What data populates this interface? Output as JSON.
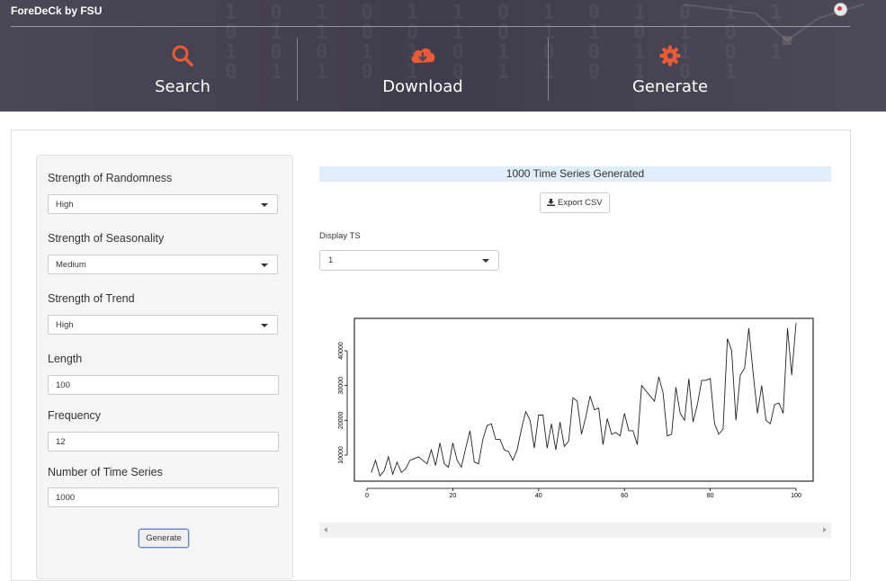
{
  "header": {
    "brand": "ForeDeCk by FSU",
    "nav": [
      {
        "label": "Search",
        "icon": "search-icon"
      },
      {
        "label": "Download",
        "icon": "cloud-download-icon"
      },
      {
        "label": "Generate",
        "icon": "gear-icon"
      }
    ],
    "accent": "#e85b36"
  },
  "sidebar": {
    "randomness": {
      "label": "Strength of Randomness",
      "value": "High"
    },
    "seasonality": {
      "label": "Strength of Seasonality",
      "value": "Medium"
    },
    "trend": {
      "label": "Strength of Trend",
      "value": "High"
    },
    "length": {
      "label": "Length",
      "value": "100"
    },
    "frequency": {
      "label": "Frequency",
      "value": "12"
    },
    "num_series": {
      "label": "Number of Time Series",
      "value": "1000"
    },
    "generate_label": "Generate"
  },
  "main": {
    "result_text": "1000 Time Series Generated",
    "export_label": "Export CSV",
    "display_label": "Display TS",
    "display_value": "1"
  },
  "chart_data": {
    "type": "line",
    "x": [
      1,
      2,
      3,
      4,
      5,
      6,
      7,
      8,
      9,
      10,
      11,
      12,
      13,
      14,
      15,
      16,
      17,
      18,
      19,
      20,
      21,
      22,
      23,
      24,
      25,
      26,
      27,
      28,
      29,
      30,
      31,
      32,
      33,
      34,
      35,
      36,
      37,
      38,
      39,
      40,
      41,
      42,
      43,
      44,
      45,
      46,
      47,
      48,
      49,
      50,
      51,
      52,
      53,
      54,
      55,
      56,
      57,
      58,
      59,
      60,
      61,
      62,
      63,
      64,
      65,
      66,
      67,
      68,
      69,
      70,
      71,
      72,
      73,
      74,
      75,
      76,
      77,
      78,
      79,
      80,
      81,
      82,
      83,
      84,
      85,
      86,
      87,
      88,
      89,
      90,
      91,
      92,
      93,
      94,
      95,
      96,
      97,
      98,
      99,
      100
    ],
    "series": [
      {
        "values": [
          5000,
          8500,
          4000,
          5500,
          9500,
          4500,
          8000,
          5000,
          6000,
          8500,
          9000,
          9500,
          8500,
          7500,
          11500,
          7000,
          13500,
          7500,
          6500,
          13500,
          8500,
          6500,
          12000,
          17000,
          8000,
          7500,
          14500,
          18500,
          19000,
          14500,
          14500,
          11500,
          11000,
          8500,
          11500,
          17500,
          22500,
          20000,
          12000,
          21500,
          21500,
          12000,
          19000,
          11500,
          19500,
          12500,
          14000,
          26500,
          25500,
          16000,
          21000,
          27000,
          23000,
          23500,
          13000,
          20500,
          16000,
          16500,
          15500,
          22000,
          17000,
          17000,
          13000,
          30000,
          28500,
          27000,
          25500,
          32500,
          28000,
          15500,
          16000,
          29500,
          22000,
          20000,
          32000,
          19500,
          24500,
          31500,
          31500,
          32000,
          19000,
          16000,
          17500,
          43500,
          40000,
          20000,
          33000,
          35000,
          46500,
          33500,
          22000,
          30000,
          20000,
          19000,
          24500,
          25000,
          22000,
          46500,
          33000,
          48000
        ]
      }
    ],
    "xlim": [
      1,
      100
    ],
    "ylim": [
      0,
      50000
    ],
    "xticks": [
      "0",
      "20",
      "40",
      "60",
      "80",
      "100"
    ],
    "yticks": [
      "10000",
      "20000",
      "30000",
      "40000"
    ]
  }
}
